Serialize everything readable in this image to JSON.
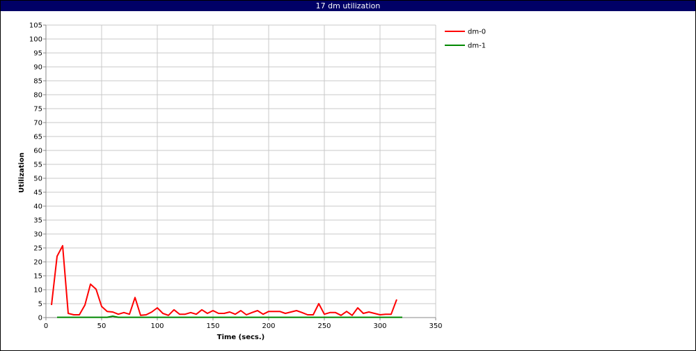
{
  "window": {
    "title": "17 dm utilization"
  },
  "chart_data": {
    "type": "line",
    "title": "17 dm utilization",
    "xlabel": "Time (secs.)",
    "ylabel": "Utilization",
    "xlim": [
      0,
      350
    ],
    "ylim": [
      0,
      105
    ],
    "xticks": [
      0,
      50,
      100,
      150,
      200,
      250,
      300,
      350
    ],
    "yticks": [
      0,
      5,
      10,
      15,
      20,
      25,
      30,
      35,
      40,
      45,
      50,
      55,
      60,
      65,
      70,
      75,
      80,
      85,
      90,
      95,
      100,
      105
    ],
    "grid": true,
    "legend_position": "top-right",
    "series": [
      {
        "name": "dm-0",
        "color": "#ff0000",
        "x": [
          5,
          10,
          15,
          20,
          25,
          30,
          35,
          40,
          45,
          50,
          55,
          60,
          65,
          70,
          75,
          80,
          85,
          90,
          95,
          100,
          105,
          110,
          115,
          120,
          125,
          130,
          135,
          140,
          145,
          150,
          155,
          160,
          165,
          170,
          175,
          180,
          185,
          190,
          195,
          200,
          205,
          210,
          215,
          220,
          225,
          230,
          235,
          240,
          245,
          250,
          255,
          260,
          265,
          270,
          275,
          280,
          285,
          290,
          295,
          300,
          305,
          310,
          315
        ],
        "y": [
          4.5,
          22,
          25.8,
          1.5,
          1,
          1,
          4.5,
          12,
          10.2,
          4,
          2.2,
          2,
          1.2,
          1.8,
          1.2,
          7.2,
          0.8,
          1,
          2,
          3.5,
          1.5,
          0.8,
          2.8,
          1.2,
          1.2,
          1.8,
          1.2,
          2.8,
          1.5,
          2.5,
          1.5,
          1.5,
          2,
          1.2,
          2.5,
          1,
          1.8,
          2.5,
          1.2,
          2.2,
          2.2,
          2.2,
          1.5,
          2,
          2.5,
          1.8,
          1,
          1,
          5,
          1.2,
          1.8,
          1.8,
          0.8,
          2.2,
          0.8,
          3.5,
          1.5,
          2,
          1.5,
          1,
          1.2,
          1.2,
          6.5
        ]
      },
      {
        "name": "dm-1",
        "color": "#008800",
        "x": [
          10,
          55,
          60,
          65,
          320
        ],
        "y": [
          0.1,
          0.1,
          0.5,
          0.1,
          0.1
        ]
      }
    ]
  }
}
